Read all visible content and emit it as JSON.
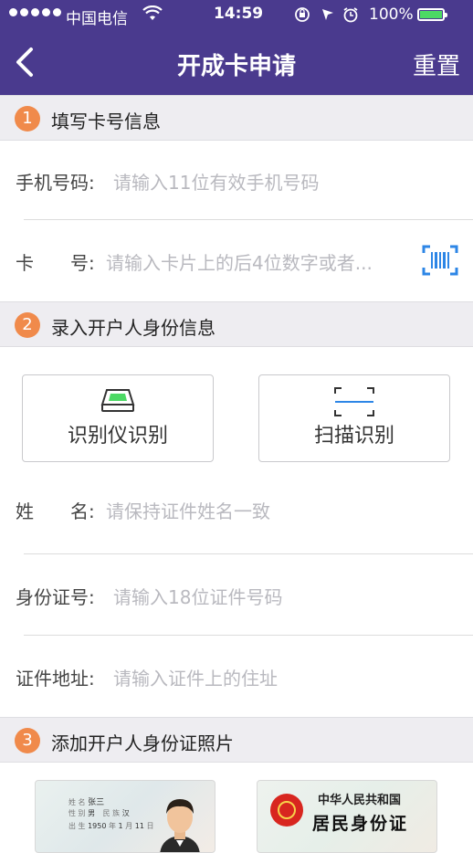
{
  "status_bar": {
    "carrier": "中国电信",
    "time": "14:59",
    "battery": "100%"
  },
  "nav": {
    "title": "开成卡申请",
    "reset_label": "重置"
  },
  "sections": [
    {
      "number": "1",
      "title": "填写卡号信息"
    },
    {
      "number": "2",
      "title": "录入开户人身份信息"
    },
    {
      "number": "3",
      "title": "添加开户人身份证照片"
    }
  ],
  "card_info": {
    "phone": {
      "label": "手机号码:",
      "placeholder": "请输入11位有效手机号码"
    },
    "card_no": {
      "label": "卡　　号:",
      "placeholder": "请输入卡片上的后4位数字或者..."
    }
  },
  "identity": {
    "reader_button": "识别仪识别",
    "scan_button": "扫描识别",
    "name": {
      "label": "姓　　名:",
      "placeholder": "请保持证件姓名一致"
    },
    "id_no": {
      "label": "身份证号:",
      "placeholder": "请输入18位证件号码"
    },
    "address": {
      "label": "证件地址:",
      "placeholder": "请输入证件上的住址"
    }
  },
  "id_photos": {
    "front": {
      "name_label": "姓 名",
      "name_value": "张三",
      "gender_label": "性 别",
      "gender_value": "男",
      "nation_label": "民 族",
      "nation_value": "汉",
      "birth_label": "出 生",
      "birth_year": "1950",
      "birth_year_unit": "年",
      "birth_month": "1",
      "birth_month_unit": "月",
      "birth_day": "11",
      "birth_day_unit": "日"
    },
    "back": {
      "country": "中华人民共和国",
      "title": "居民身份证"
    }
  },
  "colors": {
    "nav_bg": "#4a3a8e",
    "section_badge": "#f08a4b",
    "placeholder": "#b9b9bf",
    "barcode_blue": "#2d86e6"
  },
  "icons": [
    "back-chevron-icon",
    "wifi-icon",
    "lock-rotation-icon",
    "location-icon",
    "alarm-icon",
    "battery-icon",
    "barcode-scan-icon",
    "card-reader-icon",
    "scan-frame-icon"
  ]
}
